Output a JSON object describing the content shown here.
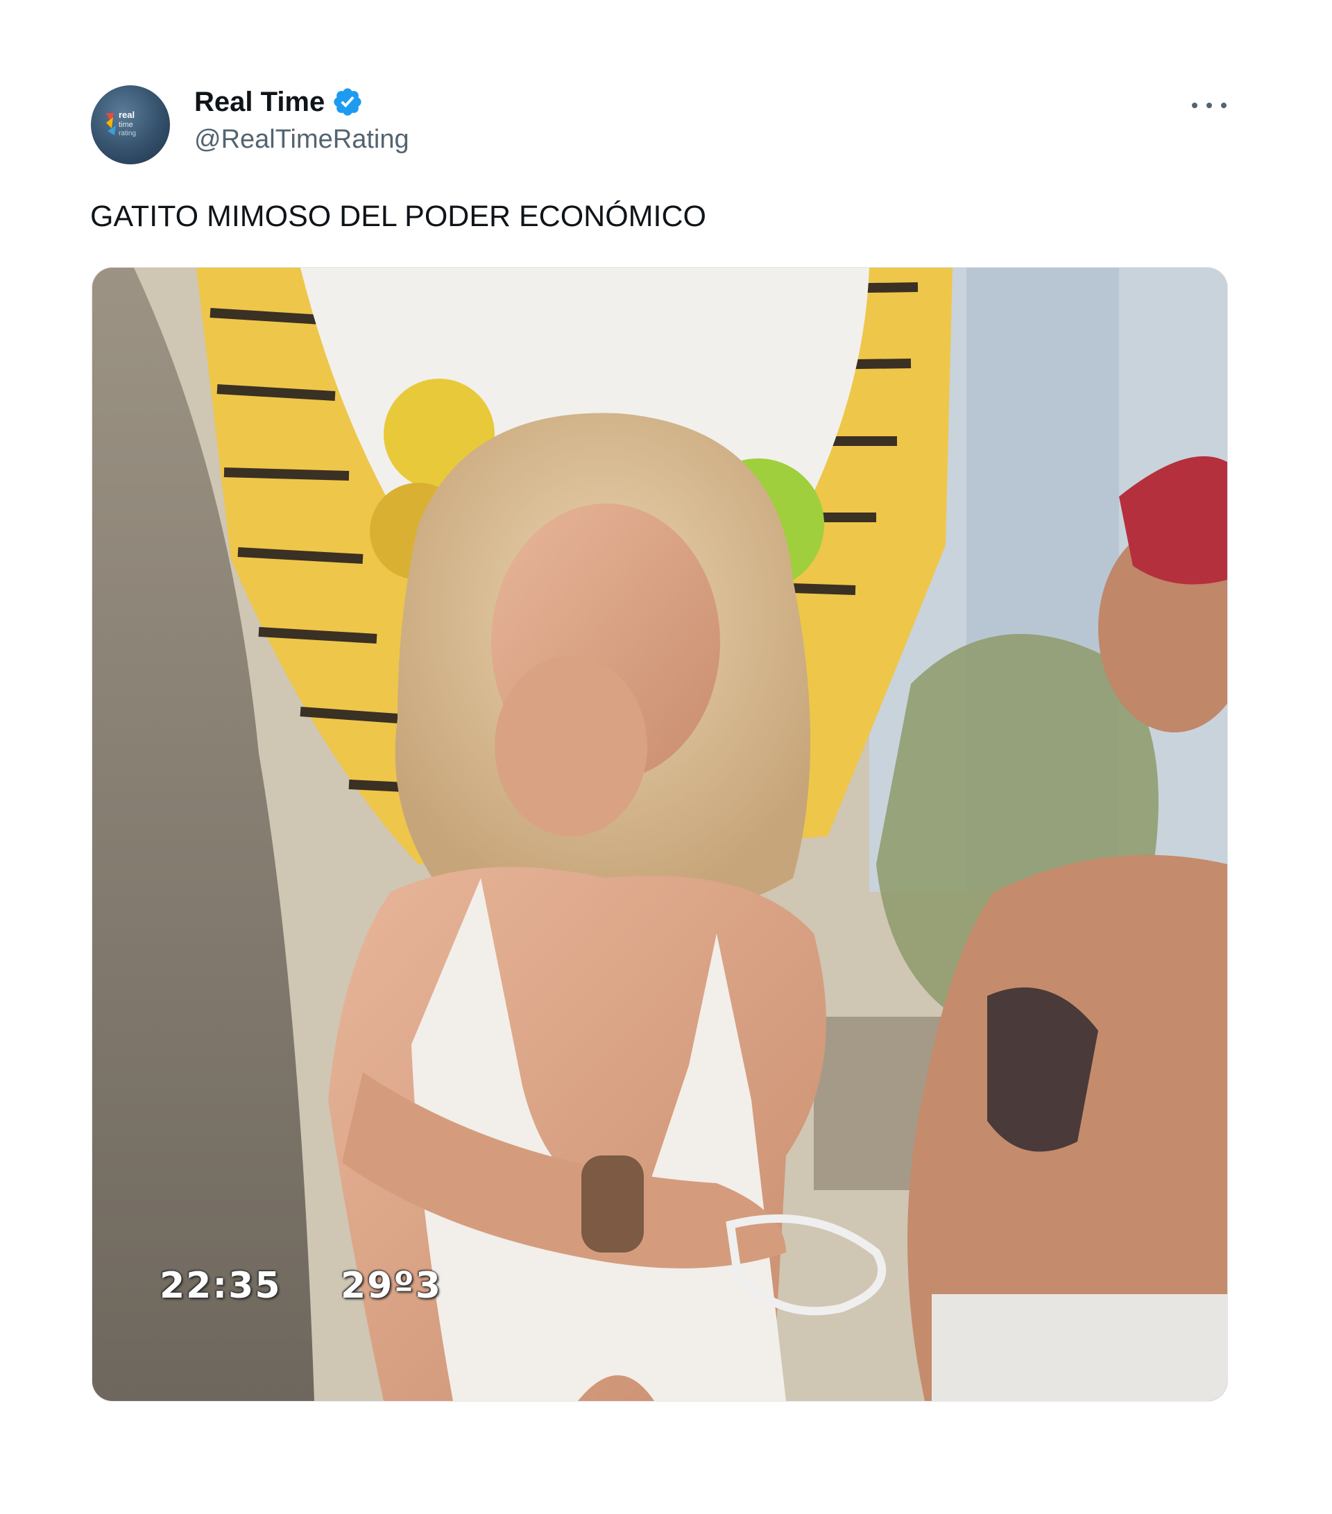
{
  "author": {
    "display_name": "Real Time",
    "handle": "@RealTimeRating",
    "verified": true,
    "avatar_text": [
      "real",
      "time",
      "rating"
    ]
  },
  "tweet": {
    "text": "GATITO MIMOSO DEL PODER ECONÓMICO"
  },
  "media": {
    "overlay_time": "22:35",
    "overlay_temp": "29º3"
  },
  "icons": {
    "verified": "verified-badge-icon",
    "more": "more-options-icon"
  },
  "colors": {
    "verified": "#1d9bf0",
    "text": "#0f1419",
    "secondary": "#536471"
  }
}
